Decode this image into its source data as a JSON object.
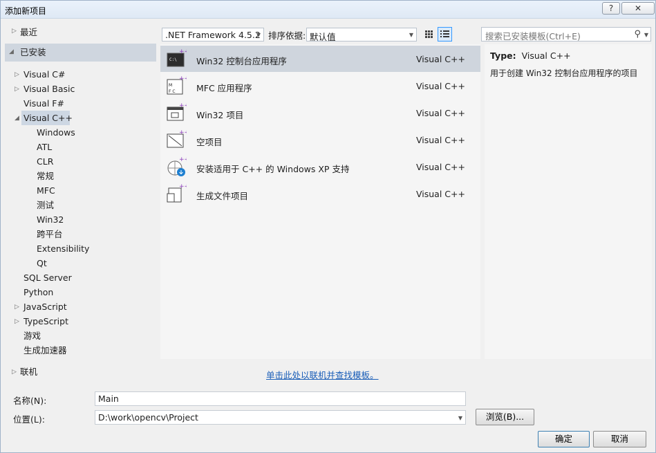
{
  "window": {
    "title": "添加新项目",
    "help_glyph": "?",
    "close_glyph": "✕"
  },
  "tree": {
    "recent": "最近",
    "installed": "已安装",
    "items": [
      {
        "label": "Visual C#",
        "expandable": true
      },
      {
        "label": "Visual Basic",
        "expandable": true
      },
      {
        "label": "Visual F#",
        "expandable": false
      },
      {
        "label": "Visual C++",
        "expandable": true,
        "expanded": true,
        "selected": true
      },
      {
        "label": "Windows",
        "child": true
      },
      {
        "label": "ATL",
        "child": true
      },
      {
        "label": "CLR",
        "child": true
      },
      {
        "label": "常规",
        "child": true
      },
      {
        "label": "MFC",
        "child": true
      },
      {
        "label": "测试",
        "child": true
      },
      {
        "label": "Win32",
        "child": true
      },
      {
        "label": "跨平台",
        "child": true
      },
      {
        "label": "Extensibility",
        "child": true
      },
      {
        "label": "Qt",
        "child": true
      },
      {
        "label": "SQL Server",
        "expandable": false
      },
      {
        "label": "Python",
        "expandable": false
      },
      {
        "label": "JavaScript",
        "expandable": true
      },
      {
        "label": "TypeScript",
        "expandable": true
      },
      {
        "label": "游戏",
        "expandable": false
      },
      {
        "label": "生成加速器",
        "expandable": false
      }
    ],
    "online": "联机"
  },
  "toolbar": {
    "framework": ".NET Framework 4.5.2",
    "sort_label": "排序依据:",
    "sort_value": "默认值",
    "search_placeholder": "搜索已安装模板(Ctrl+E)"
  },
  "templates": [
    {
      "name": "Win32 控制台应用程序",
      "lang": "Visual C++",
      "icon": "console-app-icon",
      "selected": true
    },
    {
      "name": "MFC 应用程序",
      "lang": "Visual C++",
      "icon": "mfc-app-icon"
    },
    {
      "name": "Win32 项目",
      "lang": "Visual C++",
      "icon": "win32-project-icon"
    },
    {
      "name": "空项目",
      "lang": "Visual C++",
      "icon": "empty-project-icon"
    },
    {
      "name": "安装适用于 C++ 的 Windows XP 支持",
      "lang": "Visual C++",
      "icon": "xp-support-icon"
    },
    {
      "name": "生成文件项目",
      "lang": "Visual C++",
      "icon": "makefile-project-icon"
    }
  ],
  "description": {
    "type_label": "Type:",
    "type_value": "Visual C++",
    "text": "用于创建 Win32 控制台应用程序的项目"
  },
  "online_link": "单击此处以联机并查找模板。",
  "form": {
    "name_label": "名称(N):",
    "name_value": "Main",
    "location_label": "位置(L):",
    "location_value": "D:\\work\\opencv\\Project",
    "browse_label": "浏览(B)...",
    "ok_label": "确定",
    "cancel_label": "取消"
  },
  "colors": {
    "accent": "#3399ff",
    "link": "#1a5eb8",
    "selected_row": "#cfd5dd"
  }
}
